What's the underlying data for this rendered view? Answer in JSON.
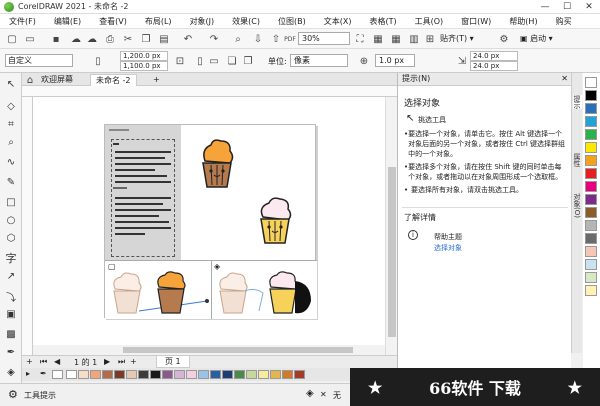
{
  "window": {
    "title": "CorelDRAW 2021 - 未命名 -2"
  },
  "menu": [
    "文件(F)",
    "编辑(E)",
    "查看(V)",
    "布局(L)",
    "对象(J)",
    "效果(C)",
    "位图(B)",
    "文本(X)",
    "表格(T)",
    "工具(O)",
    "窗口(W)",
    "帮助(H)",
    "购买"
  ],
  "toolbar": {
    "zoom": "30%",
    "snap_label": "贴齐(T)",
    "launch_label": "启动"
  },
  "propertybar": {
    "preset": "自定义",
    "width": "1,200.0 px",
    "height": "1,100.0 px",
    "units_label": "单位:",
    "units": "像素",
    "nudge": "1.0 px",
    "dup_x": "24.0 px",
    "dup_y": "24.0 px"
  },
  "tabs": [
    "欢迎屏幕",
    "未命名 -2"
  ],
  "docker": {
    "header": "提示(N)",
    "section_title": "选择对象",
    "tool_name": "挑选工具",
    "bullets": [
      "要选择一个对象，请单击它。按住 Alt 键选择一个对象后面的另一个对象，或者按住 Ctrl 键选择群组中的一个对象。",
      "要选择多个对象，请在按住 Shift 键的同时单击每个对象，或者拖动以在对象周围形成一个选取框。",
      "要选择所有对象，请双击挑选工具。"
    ],
    "learn_more": "了解详情",
    "help_topic": "帮助主题",
    "help_link": "选择对象"
  },
  "sidetabs": [
    "提示",
    "属性",
    "对象(O)"
  ],
  "pagebar": {
    "page_count": "1 的 1",
    "page_tab": "页 1"
  },
  "status": {
    "tool_hint": "工具提示",
    "fill_none": "无"
  },
  "watermark": {
    "left_star": "★",
    "text": "66软件 下载",
    "right_star": "★"
  },
  "colors": {
    "palette_v": [
      "#ffffff",
      "#000000",
      "#2d6fb7",
      "#20a3d6",
      "#2bb24c",
      "#fbe700",
      "#f5a21b",
      "#e42022",
      "#e6007e",
      "#7c2b88",
      "#8b5b2a",
      "#b5b5b5",
      "#6a6a6a",
      "#f7c7b6",
      "#c8e2f2",
      "#d7e8c4",
      "#fff2b3"
    ],
    "palette_h": [
      "#ffffff",
      "#f7dcc9",
      "#f0a67d",
      "#b06d49",
      "#7a3b26",
      "#e6c9b2",
      "#3c3c3c",
      "#1a1a1a",
      "#8a5a8a",
      "#d6b4d6",
      "#f4cfe1",
      "#9cc3e6",
      "#2b5fa4",
      "#1e3d73",
      "#4c8a4c",
      "#c6d89a",
      "#f6eb9e",
      "#e4b54a",
      "#d07a2c",
      "#a33b2a"
    ]
  }
}
